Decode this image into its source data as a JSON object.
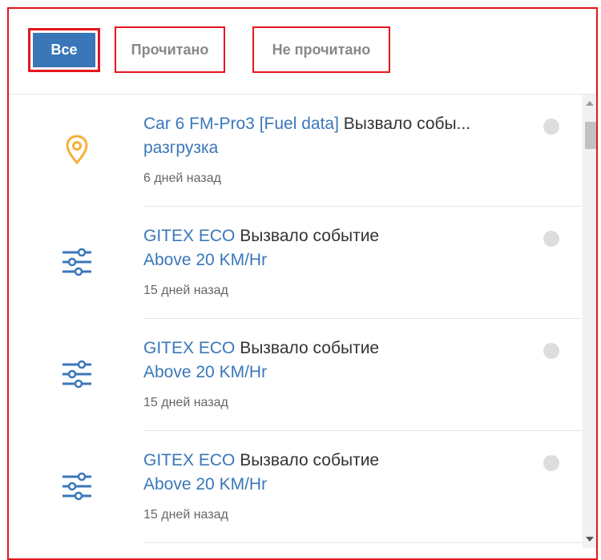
{
  "tabs": {
    "all": "Все",
    "read": "Прочитано",
    "unread": "Не прочитано"
  },
  "notifications": [
    {
      "icon": "map-pin-icon",
      "source": "Car 6 FM-Pro3 [Fuel data]",
      "action": "Вызвало собы...",
      "event": "разгрузка",
      "time": "6 дней назад"
    },
    {
      "icon": "sliders-icon",
      "source": "GITEX ECO",
      "action": "Вызвало событие",
      "event": "Above 20 KM/Hr",
      "time": "15 дней назад"
    },
    {
      "icon": "sliders-icon",
      "source": "GITEX ECO",
      "action": "Вызвало событие",
      "event": "Above 20 KM/Hr",
      "time": "15 дней назад"
    },
    {
      "icon": "sliders-icon",
      "source": "GITEX ECO",
      "action": "Вызвало событие",
      "event": "Above 20 KM/Hr",
      "time": "15 дней назад"
    }
  ],
  "colors": {
    "accent": "#3a77b9",
    "pin": "#f5b13a",
    "highlight": "#e4161e"
  }
}
